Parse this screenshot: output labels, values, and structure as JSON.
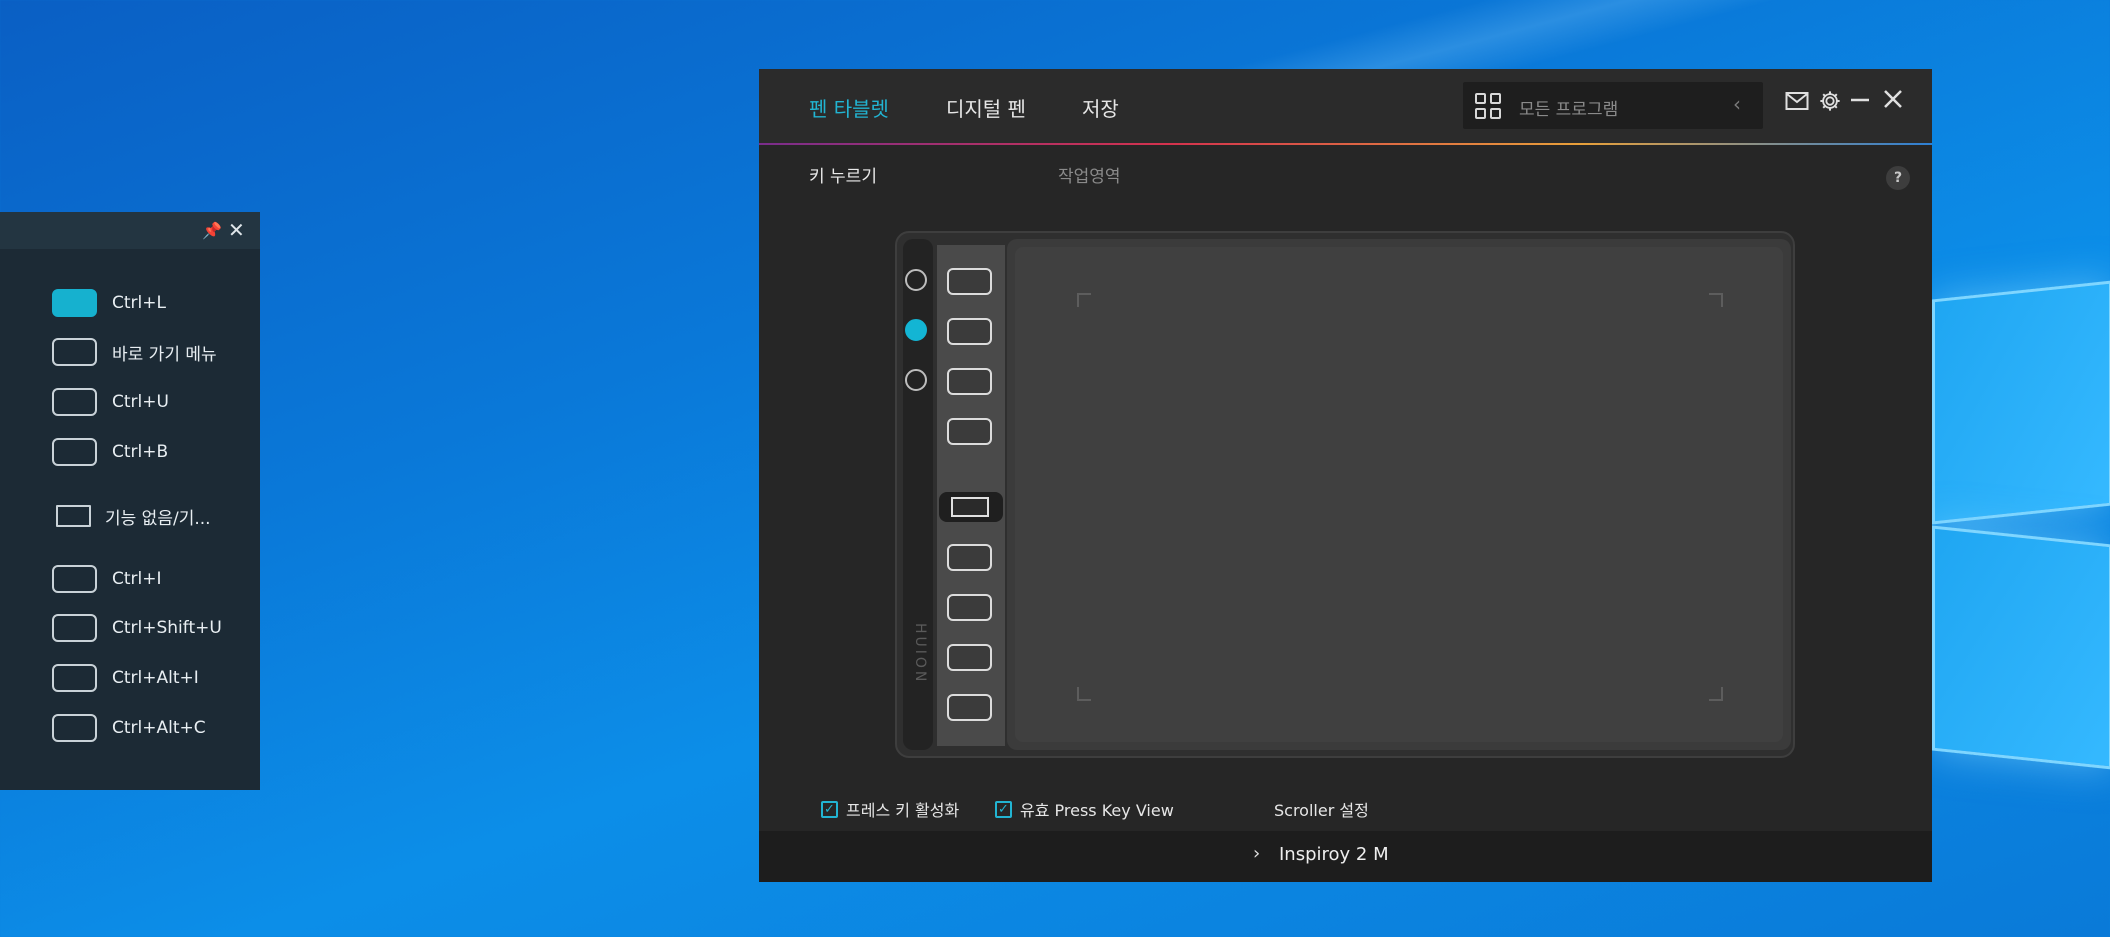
{
  "press_key_panel": {
    "keys": [
      {
        "label": "Ctrl+L",
        "active": true
      },
      {
        "label": "바로 가기 메뉴"
      },
      {
        "label": "Ctrl+U"
      },
      {
        "label": "Ctrl+B"
      },
      {
        "label": "기능 없음/기..."
      },
      {
        "label": "Ctrl+I"
      },
      {
        "label": "Ctrl+Shift+U"
      },
      {
        "label": "Ctrl+Alt+I"
      },
      {
        "label": "Ctrl+Alt+C"
      }
    ]
  },
  "app": {
    "tabs": [
      "펜 타블렛",
      "디지털 펜",
      "저장"
    ],
    "active_tab": "펜 타블렛",
    "search_placeholder": "모든 프로그램",
    "sub_tabs": [
      "키 누르기",
      "작업영역"
    ],
    "help": "?",
    "options": {
      "enable_press_key": "프레스 키 활성화",
      "valid_press_key_view": "유효 Press Key View",
      "scroller_settings": "Scroller 설정"
    },
    "brand": "HUION",
    "device_name": "Inspiroy 2 M"
  },
  "colors": {
    "accent": "#22b4d2",
    "window_bg": "#262626",
    "panel_bg": "#1c2a35"
  }
}
